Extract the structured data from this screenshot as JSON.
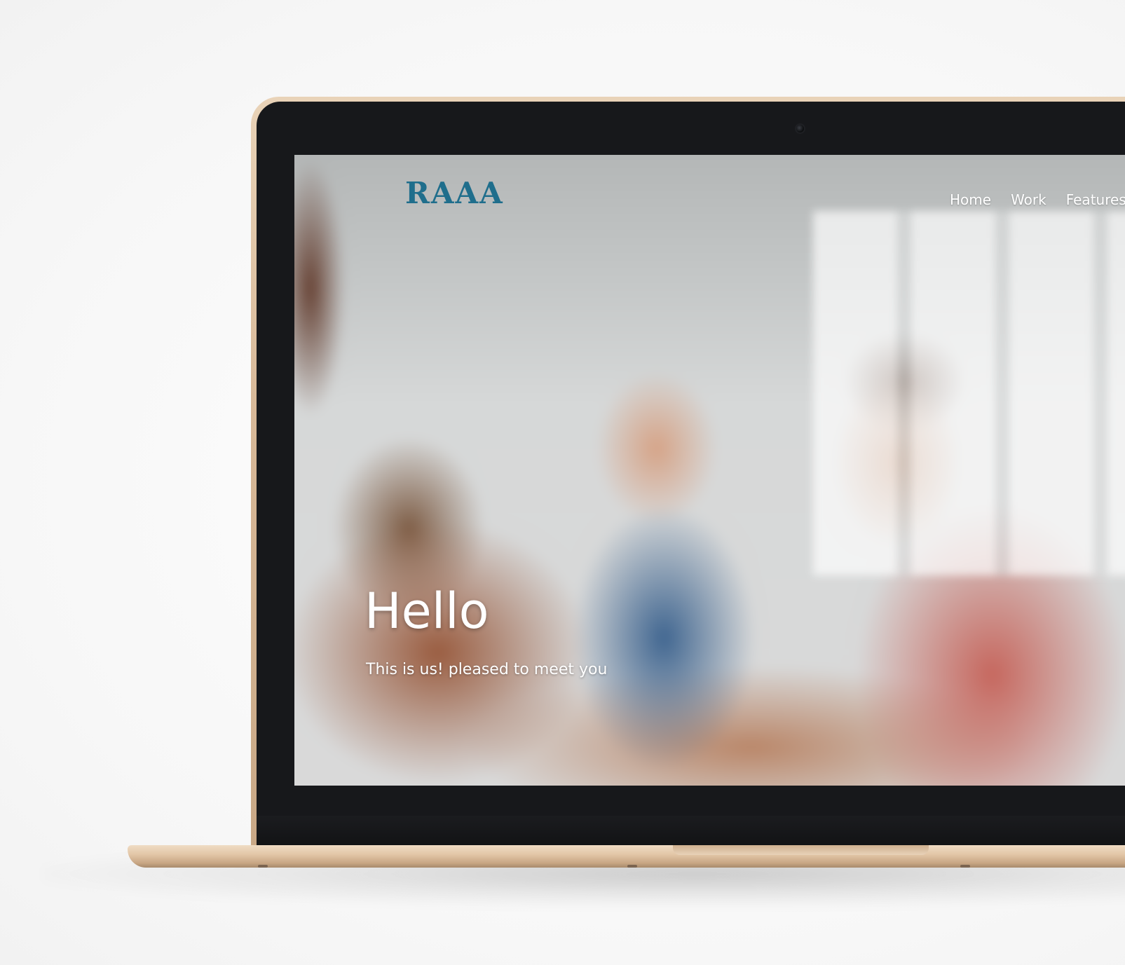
{
  "site": {
    "logo_text": "RAAA",
    "nav": [
      {
        "label": "Home"
      },
      {
        "label": "Work"
      },
      {
        "label": "Features"
      }
    ],
    "hero": {
      "title": "Hello",
      "subtitle": "This is us! pleased to meet you"
    }
  },
  "colors": {
    "logo": "#1f6e8c",
    "device_shell": "#d8b999",
    "bezel": "#17181b"
  },
  "icons": {
    "camera": "webcam-dot"
  }
}
